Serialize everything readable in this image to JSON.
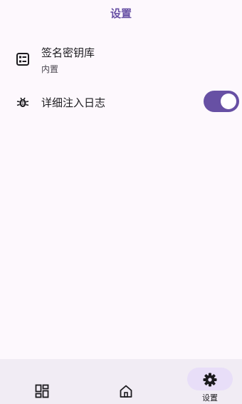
{
  "app_bar": {
    "title": "设置"
  },
  "settings": {
    "keystore": {
      "title": "签名密钥库",
      "subtitle": "内置",
      "icon": "keystore-list-icon"
    },
    "verbose_log": {
      "title": "详细注入日志",
      "icon": "bug-icon",
      "enabled": true
    }
  },
  "colors": {
    "accent": "#6750a4",
    "nav_bg": "#f1ecf4",
    "indicator": "#e8def8",
    "background": "#fdf8fd"
  },
  "bottom_nav": {
    "items": [
      {
        "id": "home",
        "icon": "dashboard-icon",
        "label": ""
      },
      {
        "id": "main",
        "icon": "home-icon",
        "label": ""
      },
      {
        "id": "settings",
        "icon": "gear-icon",
        "label": "设置",
        "selected": true
      }
    ]
  }
}
